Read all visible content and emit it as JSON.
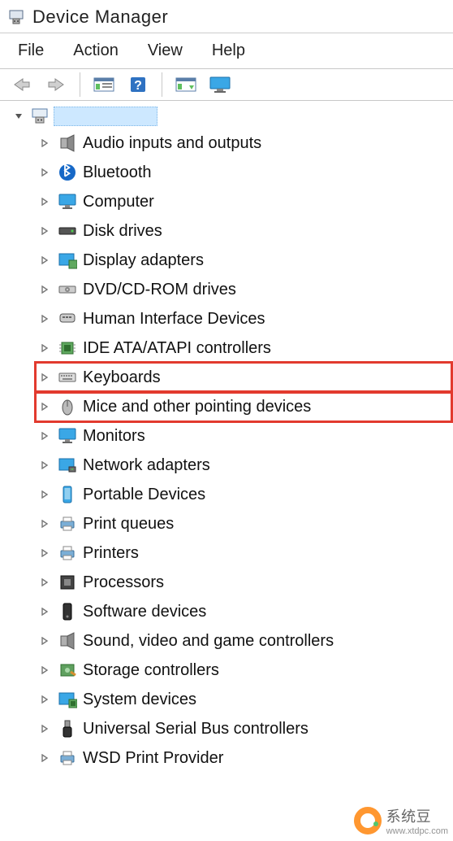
{
  "window": {
    "title": "Device Manager"
  },
  "menu": {
    "file": "File",
    "action": "Action",
    "view": "View",
    "help": "Help"
  },
  "toolbar": {
    "back": "back-arrow",
    "forward": "forward-arrow",
    "properties": "properties-icon",
    "help": "help-icon",
    "scan": "scan-hardware-icon",
    "monitor": "monitor-icon"
  },
  "root": {
    "expanded": true,
    "label": ""
  },
  "categories": [
    {
      "id": "audio",
      "icon": "speaker-icon",
      "label": "Audio inputs and outputs",
      "highlight": false
    },
    {
      "id": "bluetooth",
      "icon": "bluetooth-icon",
      "label": "Bluetooth",
      "highlight": false
    },
    {
      "id": "computer",
      "icon": "monitor-icon",
      "label": "Computer",
      "highlight": false
    },
    {
      "id": "disk",
      "icon": "drive-icon",
      "label": "Disk drives",
      "highlight": false
    },
    {
      "id": "display",
      "icon": "display-adapter-icon",
      "label": "Display adapters",
      "highlight": false
    },
    {
      "id": "dvd",
      "icon": "optical-drive-icon",
      "label": "DVD/CD-ROM drives",
      "highlight": false
    },
    {
      "id": "hid",
      "icon": "hid-icon",
      "label": "Human Interface Devices",
      "highlight": false
    },
    {
      "id": "ide",
      "icon": "chip-icon",
      "label": "IDE ATA/ATAPI controllers",
      "highlight": false
    },
    {
      "id": "keyboard",
      "icon": "keyboard-icon",
      "label": "Keyboards",
      "highlight": true
    },
    {
      "id": "mice",
      "icon": "mouse-icon",
      "label": "Mice and other pointing devices",
      "highlight": true
    },
    {
      "id": "monitors",
      "icon": "monitor-icon",
      "label": "Monitors",
      "highlight": false
    },
    {
      "id": "network",
      "icon": "network-adapter-icon",
      "label": "Network adapters",
      "highlight": false
    },
    {
      "id": "portable",
      "icon": "portable-device-icon",
      "label": "Portable Devices",
      "highlight": false
    },
    {
      "id": "printqueues",
      "icon": "printer-icon",
      "label": "Print queues",
      "highlight": false
    },
    {
      "id": "printers",
      "icon": "printer-icon",
      "label": "Printers",
      "highlight": false
    },
    {
      "id": "processors",
      "icon": "cpu-icon",
      "label": "Processors",
      "highlight": false
    },
    {
      "id": "software",
      "icon": "software-device-icon",
      "label": "Software devices",
      "highlight": false
    },
    {
      "id": "sound",
      "icon": "speaker-icon",
      "label": "Sound, video and game controllers",
      "highlight": false
    },
    {
      "id": "storagectl",
      "icon": "storage-controller-icon",
      "label": "Storage controllers",
      "highlight": false
    },
    {
      "id": "system",
      "icon": "system-device-icon",
      "label": "System devices",
      "highlight": false
    },
    {
      "id": "usb",
      "icon": "usb-icon",
      "label": "Universal Serial Bus controllers",
      "highlight": false
    },
    {
      "id": "wsd",
      "icon": "printer-icon",
      "label": "WSD Print Provider",
      "highlight": false
    }
  ],
  "watermark": {
    "brand": "系统豆",
    "url": "www.xtdpc.com"
  }
}
